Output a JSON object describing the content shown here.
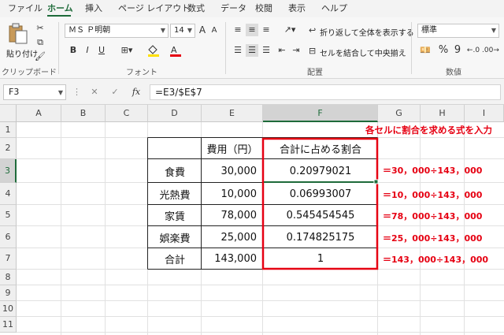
{
  "menu": [
    "ファイル",
    "ホーム",
    "挿入",
    "ページ レイアウト",
    "数式",
    "データ",
    "校閲",
    "表示",
    "ヘルプ"
  ],
  "ribbon": {
    "paste_label": "貼り付け",
    "clipboard_label": "クリップボード",
    "font_name": "ＭＳ Ｐ明朝",
    "font_size": "14",
    "font_label": "フォント",
    "wrap_text": "折り返して全体を表示する",
    "merge_center": "セルを結合して中央揃え",
    "alignment_label": "配置",
    "number_format": "標準",
    "number_label": "数値",
    "grow_font": "A",
    "shrink_font": "A",
    "bold": "B",
    "italic": "I",
    "underline": "U",
    "percent": "%",
    "comma": "9"
  },
  "formula_bar": {
    "name_box": "F3",
    "fx": "fx",
    "formula": "=E3/$E$7"
  },
  "grid": {
    "columns": [
      "A",
      "B",
      "C",
      "D",
      "E",
      "F",
      "G",
      "H",
      "I"
    ],
    "rows": [
      "1",
      "2",
      "3",
      "4",
      "5",
      "6",
      "7",
      "8",
      "9",
      "10",
      "11"
    ],
    "selected_column": "F",
    "selected_row": "3"
  },
  "table": {
    "header": [
      "",
      "費用（円）",
      "合計に占める割合"
    ],
    "rows": [
      {
        "label": "食費",
        "cost": "30,000",
        "ratio": "0.20979021"
      },
      {
        "label": "光熱費",
        "cost": "10,000",
        "ratio": "0.06993007"
      },
      {
        "label": "家賃",
        "cost": "78,000",
        "ratio": "0.545454545"
      },
      {
        "label": "娯楽費",
        "cost": "25,000",
        "ratio": "0.174825175"
      },
      {
        "label": "合計",
        "cost": "143,000",
        "ratio": "1"
      }
    ]
  },
  "annotations": {
    "title": "各セルに割合を求める式を入力",
    "formulas": [
      "＝30，000÷143，000",
      "＝10，000÷143，000",
      "＝78，000÷143，000",
      "＝25，000÷143，000",
      "＝143，000÷143，000"
    ]
  },
  "colors": {
    "accent": "#1e6b3a",
    "highlight_red": "#e60012"
  }
}
